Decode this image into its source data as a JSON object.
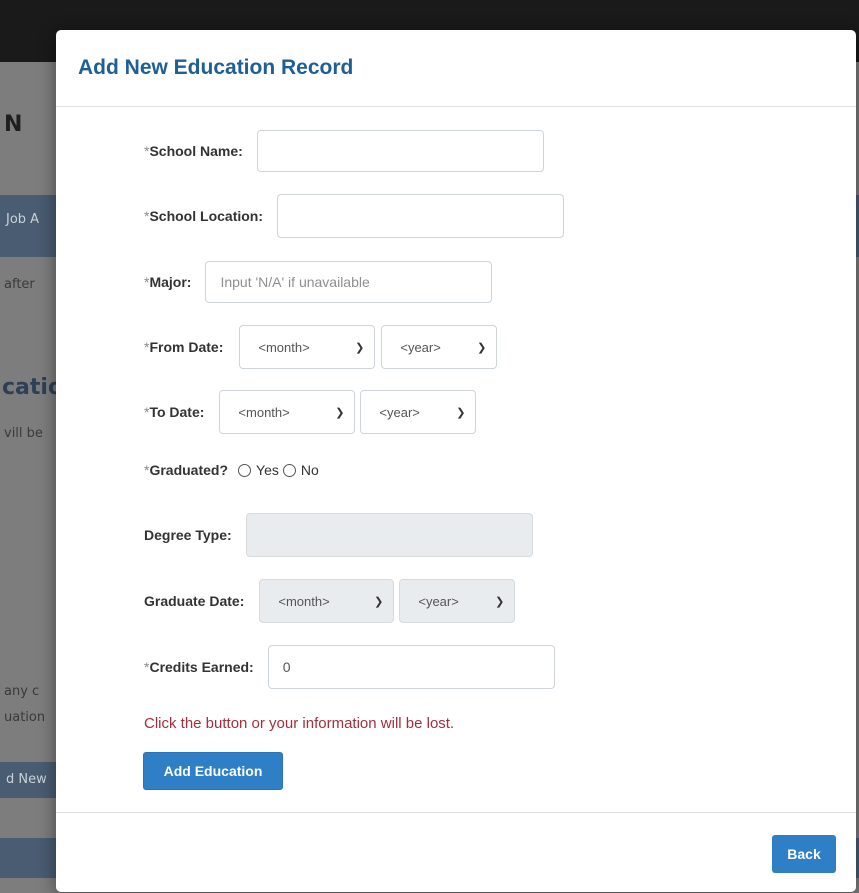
{
  "background": {
    "letter": "N",
    "nav_text": "Job A",
    "after_text": "after",
    "section_heading": "catio",
    "will_text": "vill be",
    "any_text": "any c",
    "uation_text": "uation",
    "add_new_text": "d New"
  },
  "modal": {
    "title": "Add New Education Record",
    "school_name": {
      "required": "*",
      "label": "School Name:",
      "value": ""
    },
    "school_location": {
      "required": "*",
      "label": "School Location:",
      "value": ""
    },
    "major": {
      "required": "*",
      "label": "Major:",
      "placeholder": "Input 'N/A' if unavailable",
      "value": ""
    },
    "from_date": {
      "required": "*",
      "label": "From Date:",
      "month": "<month>",
      "year": "<year>"
    },
    "to_date": {
      "required": "*",
      "label": "To Date:",
      "month": "<month>",
      "year": "<year>"
    },
    "graduated": {
      "required": "*",
      "label": "Graduated?",
      "options": [
        "Yes",
        "No"
      ]
    },
    "degree_type": {
      "label": "Degree Type:",
      "value": ""
    },
    "graduate_date": {
      "label": "Graduate Date:",
      "month": "<month>",
      "year": "<year>"
    },
    "credits_earned": {
      "required": "*",
      "label": "Credits Earned:",
      "value": "0"
    },
    "warning": "Click the button or your information will be lost.",
    "add_button": "Add Education",
    "back_button": "Back"
  },
  "colors": {
    "title": "#1d5f96",
    "primary_button": "#2e7fc5",
    "warning_text": "#a42e3b"
  }
}
